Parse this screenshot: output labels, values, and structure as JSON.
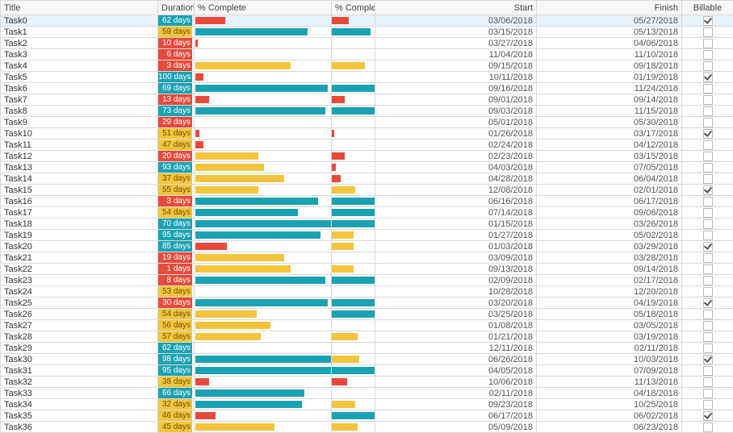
{
  "colors": {
    "teal": "#1aa2b3",
    "yellow": "#f3c53c",
    "red": "#e74a3b"
  },
  "headers": {
    "title": "Title",
    "duration": "Duration",
    "pc_bar": "% Complete",
    "pc_mini": "% Complete",
    "start": "Start",
    "finish": "Finish",
    "billable": "Billable"
  },
  "selected_row": 0,
  "rows": [
    {
      "title": "Task0",
      "dur_text": "62 days",
      "dur_color": "teal",
      "pc": 22,
      "pc_color": "red",
      "cb": 40,
      "cb_color": "red",
      "start": "03/06/2018",
      "finish": "05/27/2018",
      "billable": true
    },
    {
      "title": "Task1",
      "dur_text": "59 days",
      "dur_color": "yellow",
      "pc": 82,
      "pc_color": "teal",
      "cb": 90,
      "cb_color": "teal",
      "start": "03/15/2018",
      "finish": "05/13/2018",
      "billable": false
    },
    {
      "title": "Task2",
      "dur_text": "10 days",
      "dur_color": "red",
      "pc": 2,
      "pc_color": "red",
      "cb": 0,
      "cb_color": "red",
      "start": "03/27/2018",
      "finish": "04/06/2018",
      "billable": false
    },
    {
      "title": "Task3",
      "dur_text": "6 days",
      "dur_color": "red",
      "pc": 0,
      "pc_color": "red",
      "cb": 0,
      "cb_color": "red",
      "start": "11/04/2018",
      "finish": "11/10/2018",
      "billable": false
    },
    {
      "title": "Task4",
      "dur_text": "3 days",
      "dur_color": "red",
      "pc": 70,
      "pc_color": "yellow",
      "cb": 78,
      "cb_color": "yellow",
      "start": "09/15/2018",
      "finish": "09/18/2018",
      "billable": false
    },
    {
      "title": "Task5",
      "dur_text": "100 days",
      "dur_color": "teal",
      "pc": 6,
      "pc_color": "red",
      "cb": 0,
      "cb_color": "red",
      "start": "10/11/2018",
      "finish": "01/19/2018",
      "billable": true
    },
    {
      "title": "Task6",
      "dur_text": "69 days",
      "dur_color": "teal",
      "pc": 97,
      "pc_color": "teal",
      "cb": 100,
      "cb_color": "teal",
      "start": "09/16/2018",
      "finish": "11/24/2018",
      "billable": false
    },
    {
      "title": "Task7",
      "dur_text": "13 days",
      "dur_color": "red",
      "pc": 10,
      "pc_color": "red",
      "cb": 30,
      "cb_color": "red",
      "start": "09/01/2018",
      "finish": "09/14/2018",
      "billable": false
    },
    {
      "title": "Task8",
      "dur_text": "73 days",
      "dur_color": "teal",
      "pc": 95,
      "pc_color": "teal",
      "cb": 100,
      "cb_color": "teal",
      "start": "09/03/2018",
      "finish": "11/15/2018",
      "billable": false
    },
    {
      "title": "Task9",
      "dur_text": "29 days",
      "dur_color": "red",
      "pc": 0,
      "pc_color": "red",
      "cb": 0,
      "cb_color": "red",
      "start": "05/01/2018",
      "finish": "05/30/2018",
      "billable": false
    },
    {
      "title": "Task10",
      "dur_text": "51 days",
      "dur_color": "yellow",
      "pc": 3,
      "pc_color": "red",
      "cb": 5,
      "cb_color": "red",
      "start": "01/26/2018",
      "finish": "03/17/2018",
      "billable": true
    },
    {
      "title": "Task11",
      "dur_text": "47 days",
      "dur_color": "yellow",
      "pc": 6,
      "pc_color": "red",
      "cb": 0,
      "cb_color": "red",
      "start": "02/24/2018",
      "finish": "04/12/2018",
      "billable": false
    },
    {
      "title": "Task12",
      "dur_text": "20 days",
      "dur_color": "red",
      "pc": 46,
      "pc_color": "yellow",
      "cb": 30,
      "cb_color": "red",
      "start": "02/23/2018",
      "finish": "03/15/2018",
      "billable": false
    },
    {
      "title": "Task13",
      "dur_text": "93 days",
      "dur_color": "teal",
      "pc": 50,
      "pc_color": "yellow",
      "cb": 10,
      "cb_color": "red",
      "start": "04/03/2018",
      "finish": "07/05/2018",
      "billable": false
    },
    {
      "title": "Task14",
      "dur_text": "37 days",
      "dur_color": "yellow",
      "pc": 65,
      "pc_color": "yellow",
      "cb": 20,
      "cb_color": "red",
      "start": "04/28/2018",
      "finish": "06/04/2018",
      "billable": false
    },
    {
      "title": "Task15",
      "dur_text": "55 days",
      "dur_color": "yellow",
      "pc": 46,
      "pc_color": "yellow",
      "cb": 55,
      "cb_color": "yellow",
      "start": "12/08/2018",
      "finish": "02/01/2018",
      "billable": true
    },
    {
      "title": "Task16",
      "dur_text": "3 days",
      "dur_color": "red",
      "pc": 90,
      "pc_color": "teal",
      "cb": 100,
      "cb_color": "teal",
      "start": "06/16/2018",
      "finish": "06/17/2018",
      "billable": false
    },
    {
      "title": "Task17",
      "dur_text": "54 days",
      "dur_color": "yellow",
      "pc": 75,
      "pc_color": "teal",
      "cb": 100,
      "cb_color": "teal",
      "start": "07/14/2018",
      "finish": "09/06/2018",
      "billable": false
    },
    {
      "title": "Task18",
      "dur_text": "70 days",
      "dur_color": "teal",
      "pc": 100,
      "pc_color": "teal",
      "cb": 100,
      "cb_color": "teal",
      "start": "01/15/2018",
      "finish": "03/26/2018",
      "billable": false
    },
    {
      "title": "Task19",
      "dur_text": "95 days",
      "dur_color": "teal",
      "pc": 92,
      "pc_color": "teal",
      "cb": 50,
      "cb_color": "yellow",
      "start": "01/27/2018",
      "finish": "05/02/2018",
      "billable": false
    },
    {
      "title": "Task20",
      "dur_text": "85 days",
      "dur_color": "teal",
      "pc": 23,
      "pc_color": "red",
      "cb": 50,
      "cb_color": "yellow",
      "start": "01/03/2018",
      "finish": "03/29/2018",
      "billable": true
    },
    {
      "title": "Task21",
      "dur_text": "19 days",
      "dur_color": "red",
      "pc": 65,
      "pc_color": "yellow",
      "cb": 0,
      "cb_color": "red",
      "start": "03/09/2018",
      "finish": "03/28/2018",
      "billable": false
    },
    {
      "title": "Task22",
      "dur_text": "1 days",
      "dur_color": "red",
      "pc": 70,
      "pc_color": "yellow",
      "cb": 50,
      "cb_color": "yellow",
      "start": "09/13/2018",
      "finish": "09/14/2018",
      "billable": false
    },
    {
      "title": "Task23",
      "dur_text": "8 days",
      "dur_color": "red",
      "pc": 95,
      "pc_color": "teal",
      "cb": 100,
      "cb_color": "teal",
      "start": "02/09/2018",
      "finish": "02/17/2018",
      "billable": false
    },
    {
      "title": "Task24",
      "dur_text": "53 days",
      "dur_color": "yellow",
      "pc": 0,
      "pc_color": "red",
      "cb": 0,
      "cb_color": "red",
      "start": "10/28/2018",
      "finish": "12/20/2018",
      "billable": false
    },
    {
      "title": "Task25",
      "dur_text": "30 days",
      "dur_color": "red",
      "pc": 97,
      "pc_color": "teal",
      "cb": 100,
      "cb_color": "teal",
      "start": "03/20/2018",
      "finish": "04/19/2018",
      "billable": true
    },
    {
      "title": "Task26",
      "dur_text": "54 days",
      "dur_color": "yellow",
      "pc": 45,
      "pc_color": "yellow",
      "cb": 100,
      "cb_color": "teal",
      "start": "03/25/2018",
      "finish": "05/18/2018",
      "billable": false
    },
    {
      "title": "Task27",
      "dur_text": "56 days",
      "dur_color": "yellow",
      "pc": 55,
      "pc_color": "yellow",
      "cb": 0,
      "cb_color": "red",
      "start": "01/08/2018",
      "finish": "03/05/2018",
      "billable": false
    },
    {
      "title": "Task28",
      "dur_text": "57 days",
      "dur_color": "yellow",
      "pc": 48,
      "pc_color": "yellow",
      "cb": 60,
      "cb_color": "yellow",
      "start": "01/21/2018",
      "finish": "03/19/2018",
      "billable": false
    },
    {
      "title": "Task29",
      "dur_text": "62 days",
      "dur_color": "teal",
      "pc": 0,
      "pc_color": "red",
      "cb": 0,
      "cb_color": "red",
      "start": "12/11/2018",
      "finish": "02/11/2018",
      "billable": false
    },
    {
      "title": "Task30",
      "dur_text": "98 days",
      "dur_color": "teal",
      "pc": 100,
      "pc_color": "teal",
      "cb": 65,
      "cb_color": "yellow",
      "start": "06/26/2018",
      "finish": "10/03/2018",
      "billable": true
    },
    {
      "title": "Task31",
      "dur_text": "95 days",
      "dur_color": "teal",
      "pc": 100,
      "pc_color": "teal",
      "cb": 100,
      "cb_color": "teal",
      "start": "04/05/2018",
      "finish": "07/09/2018",
      "billable": false
    },
    {
      "title": "Task32",
      "dur_text": "38 days",
      "dur_color": "yellow",
      "pc": 10,
      "pc_color": "red",
      "cb": 35,
      "cb_color": "red",
      "start": "10/06/2018",
      "finish": "11/13/2018",
      "billable": false
    },
    {
      "title": "Task33",
      "dur_text": "66 days",
      "dur_color": "teal",
      "pc": 80,
      "pc_color": "teal",
      "cb": 0,
      "cb_color": "red",
      "start": "02/11/2018",
      "finish": "04/18/2018",
      "billable": false
    },
    {
      "title": "Task34",
      "dur_text": "32 days",
      "dur_color": "yellow",
      "pc": 78,
      "pc_color": "teal",
      "cb": 55,
      "cb_color": "yellow",
      "start": "09/23/2018",
      "finish": "10/25/2018",
      "billable": false
    },
    {
      "title": "Task35",
      "dur_text": "46 days",
      "dur_color": "yellow",
      "pc": 15,
      "pc_color": "red",
      "cb": 100,
      "cb_color": "teal",
      "start": "06/17/2018",
      "finish": "06/02/2018",
      "billable": true
    },
    {
      "title": "Task36",
      "dur_text": "45 days",
      "dur_color": "yellow",
      "pc": 58,
      "pc_color": "yellow",
      "cb": 60,
      "cb_color": "yellow",
      "start": "05/09/2018",
      "finish": "06/23/2018",
      "billable": false
    }
  ]
}
